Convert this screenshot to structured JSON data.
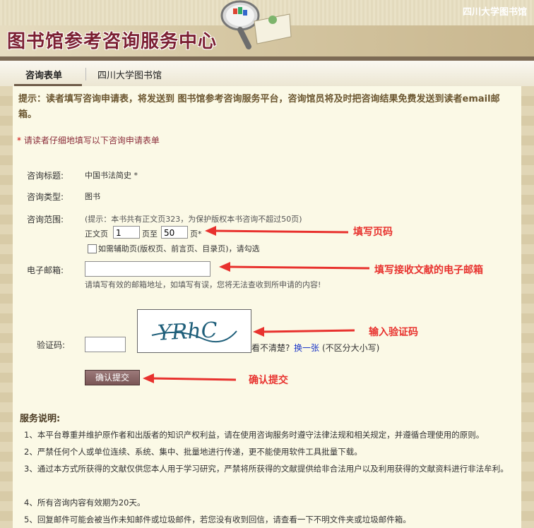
{
  "header": {
    "title": "图书馆参考咨询服务中心",
    "site": "四川大学图书馆"
  },
  "nav": {
    "tabs": [
      {
        "label": "咨询表单",
        "active": true
      },
      {
        "label": "四川大学图书馆",
        "active": false
      }
    ]
  },
  "tip": "提示：读者填写咨询申请表，将发送到 图书馆参考咨询服务平台，咨询馆员将及时把咨询结果免费发送到读者email邮箱。",
  "notice": {
    "star": "*",
    "text": " 请读者仔细地填写以下咨询申请表单"
  },
  "form": {
    "title_label": "咨询标题:",
    "title_value": "中国书法简史 *",
    "type_label": "咨询类型:",
    "type_value": "图书",
    "range_label": "咨询范围:",
    "range_hint": "(提示：本书共有正文页323，为保护版权本书咨询不超过50页)",
    "range_prefix": "正文页",
    "range_from": "1",
    "range_mid": "页至",
    "range_to": "50",
    "range_suffix": "页*",
    "aux_pages_label": "如需辅助页(版权页、前言页、目录页)，请勾选",
    "email_label": "电子邮箱:",
    "email_value": "",
    "email_hint": "请填写有效的邮箱地址，如填写有误，您将无法查收到所申请的内容!",
    "captcha_label": "验证码:",
    "captcha_value": "",
    "captcha_text": "YRhC",
    "captcha_unclear": "看不清楚?",
    "captcha_refresh": "换一张",
    "captcha_case": "(不区分大小写)",
    "submit_label": "确认提交"
  },
  "annotations": {
    "fill_pages": "填写页码",
    "fill_email": "填写接收文献的电子邮箱",
    "enter_captcha": "输入验证码",
    "confirm_submit": "确认提交"
  },
  "service": {
    "title": "服务说明:",
    "items": [
      "1、本平台尊重并维护原作者和出版者的知识产权利益，请在使用咨询服务时遵守法律法规和相关规定，并遵循合理使用的原则。",
      "2、严禁任何个人或单位连续、系统、集中、批量地进行传递，更不能使用软件工具批量下载。",
      "3、通过本方式所获得的文献仅供您本人用于学习研究，严禁将所获得的文献提供给非合法用户以及利用获得的文献资料进行非法牟利。",
      "4、所有咨询内容有效期为20天。",
      "5、回复邮件可能会被当作未知邮件或垃圾邮件，若您没有收到回信，请查看一下不明文件夹或垃圾邮件箱。"
    ]
  },
  "colors": {
    "annotation": "#e8322e",
    "title": "#7b1f32",
    "notice": "#8b2d3a",
    "link": "#1a35c7"
  }
}
